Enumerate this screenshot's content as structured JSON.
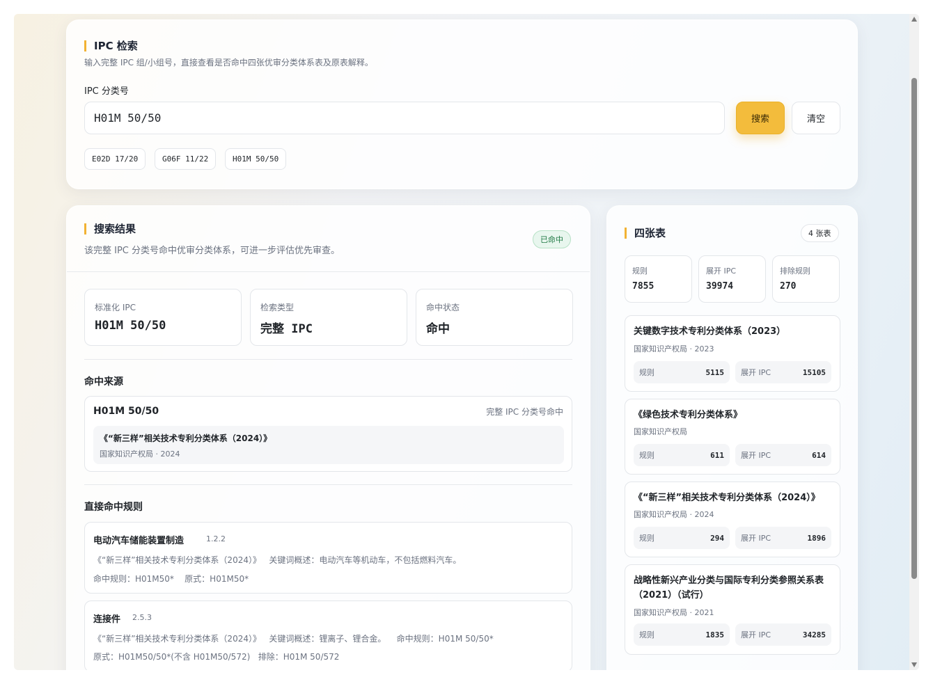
{
  "search": {
    "title": "IPC 检索",
    "subtitle": "输入完整 IPC 组/小组号，直接查看是否命中四张优审分类体系表及原表解释。",
    "field_label": "IPC 分类号",
    "input_value": "H01M 50/50",
    "search_button": "搜索",
    "clear_button": "清空",
    "examples": [
      "E02D 17/20",
      "G06F 11/22",
      "H01M 50/50"
    ]
  },
  "result": {
    "title": "搜索结果",
    "subtitle": "该完整 IPC 分类号命中优审分类体系，可进一步评估优先审查。",
    "badge": "已命中",
    "info": [
      {
        "label": "标准化 IPC",
        "value": "H01M 50/50"
      },
      {
        "label": "检索类型",
        "value": "完整 IPC"
      },
      {
        "label": "命中状态",
        "value": "命中"
      }
    ],
    "sources_title": "命中来源",
    "source": {
      "code": "H01M 50/50",
      "match_type": "完整 IPC 分类号命中",
      "system": "《“新三样”相关技术专利分类体系（2024）》",
      "meta": "国家知识产权局 · 2024"
    },
    "rules_title": "直接命中规则",
    "rules": [
      {
        "name": "电动汽车储能装置制造",
        "code": "1.2.2",
        "line1": "《“新三样”相关技术专利分类体系（2024）》   关键词概述：电动汽车等机动车，不包括燃料汽车。",
        "line2": "命中规则：H01M50*    原式：H01M50*"
      },
      {
        "name": "连接件",
        "code": "2.5.3",
        "line1": "《“新三样”相关技术专利分类体系（2024）》   关键词概述：锂离子、锂合金。    命中规则：H01M 50/50*",
        "line2": "原式：H01M50/50*(不含 H01M50/572)   排除：H01M 50/572"
      }
    ]
  },
  "tables": {
    "title": "四张表",
    "badge": "4 张表",
    "stats": [
      {
        "label": "规则",
        "value": "7855"
      },
      {
        "label": "展开 IPC",
        "value": "39974"
      },
      {
        "label": "排除规则",
        "value": "270"
      }
    ],
    "rule_label": "规则",
    "ipc_label": "展开 IPC",
    "items": [
      {
        "name": "关键数字技术专利分类体系（2023）",
        "meta": "国家知识产权局 · 2023",
        "rules": "5115",
        "ipc": "15105"
      },
      {
        "name": "《绿色技术专利分类体系》",
        "meta": "国家知识产权局",
        "rules": "611",
        "ipc": "614"
      },
      {
        "name": "《“新三样”相关技术专利分类体系（2024）》",
        "meta": "国家知识产权局 · 2024",
        "rules": "294",
        "ipc": "1896"
      },
      {
        "name": "战略性新兴产业分类与国际专利分类参照关系表（2021）（试行）",
        "meta": "国家知识产权局 · 2021",
        "rules": "1835",
        "ipc": "34285"
      }
    ]
  }
}
